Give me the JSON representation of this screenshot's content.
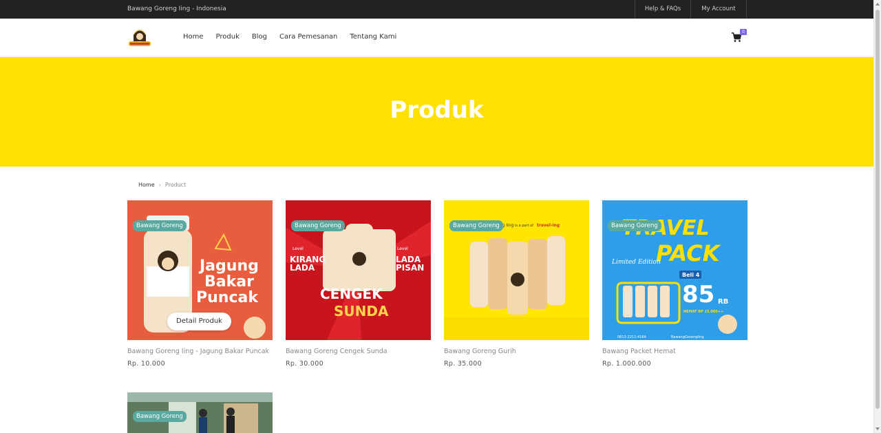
{
  "topbar": {
    "location": "Bawang Goreng Iing - Indonesia",
    "help": "Help & FAQs",
    "account": "My Account"
  },
  "nav": {
    "menu": [
      "Home",
      "Produk",
      "Blog",
      "Cara Pemesanan",
      "Tentang Kami"
    ],
    "cart_count": "0"
  },
  "hero": {
    "title": "Produk"
  },
  "breadcrumb": {
    "home": "Home",
    "separator": "›",
    "current": "Product"
  },
  "products": [
    {
      "tag": "Bawang Goreng",
      "name": "Bawang Goreng Iing - Jagung Bakar Puncak",
      "price": "Rp. 10.000",
      "button": "Detail Produk",
      "image_text": [
        "Jagung",
        "Bakar",
        "Puncak"
      ]
    },
    {
      "tag": "Bawang Goreng",
      "name": "Bawang Goreng Cengek Sunda",
      "price": "Rp. 30.000",
      "image_text": [
        "Level",
        "KIRANG",
        "LADA",
        "Level",
        "LADA",
        "PISAN",
        "CENGEK",
        "SUNDA"
      ]
    },
    {
      "tag": "Bawang Goreng",
      "name": "Bawang Goreng Gurih",
      "price": "Rp. 35.000",
      "image_text": [
        "eng Iing",
        "is a part of",
        "travel-ing"
      ]
    },
    {
      "tag": "Bawang Goreng",
      "name": "Bawang Packet Hemat",
      "price": "Rp. 1.000.000",
      "image_text": [
        "TRAVEL",
        "PACK",
        "Limited Edition",
        "Beli 4",
        "85",
        "RB",
        "HEMAT RP 15.000++",
        "0813-2211-4164",
        "BawangGorengIing"
      ]
    },
    {
      "tag": "Bawang Goreng"
    }
  ],
  "colors": {
    "hero": "#ffe000",
    "topbar": "#222222",
    "tag": "#5aa9a0",
    "badge": "#7b68ee"
  }
}
